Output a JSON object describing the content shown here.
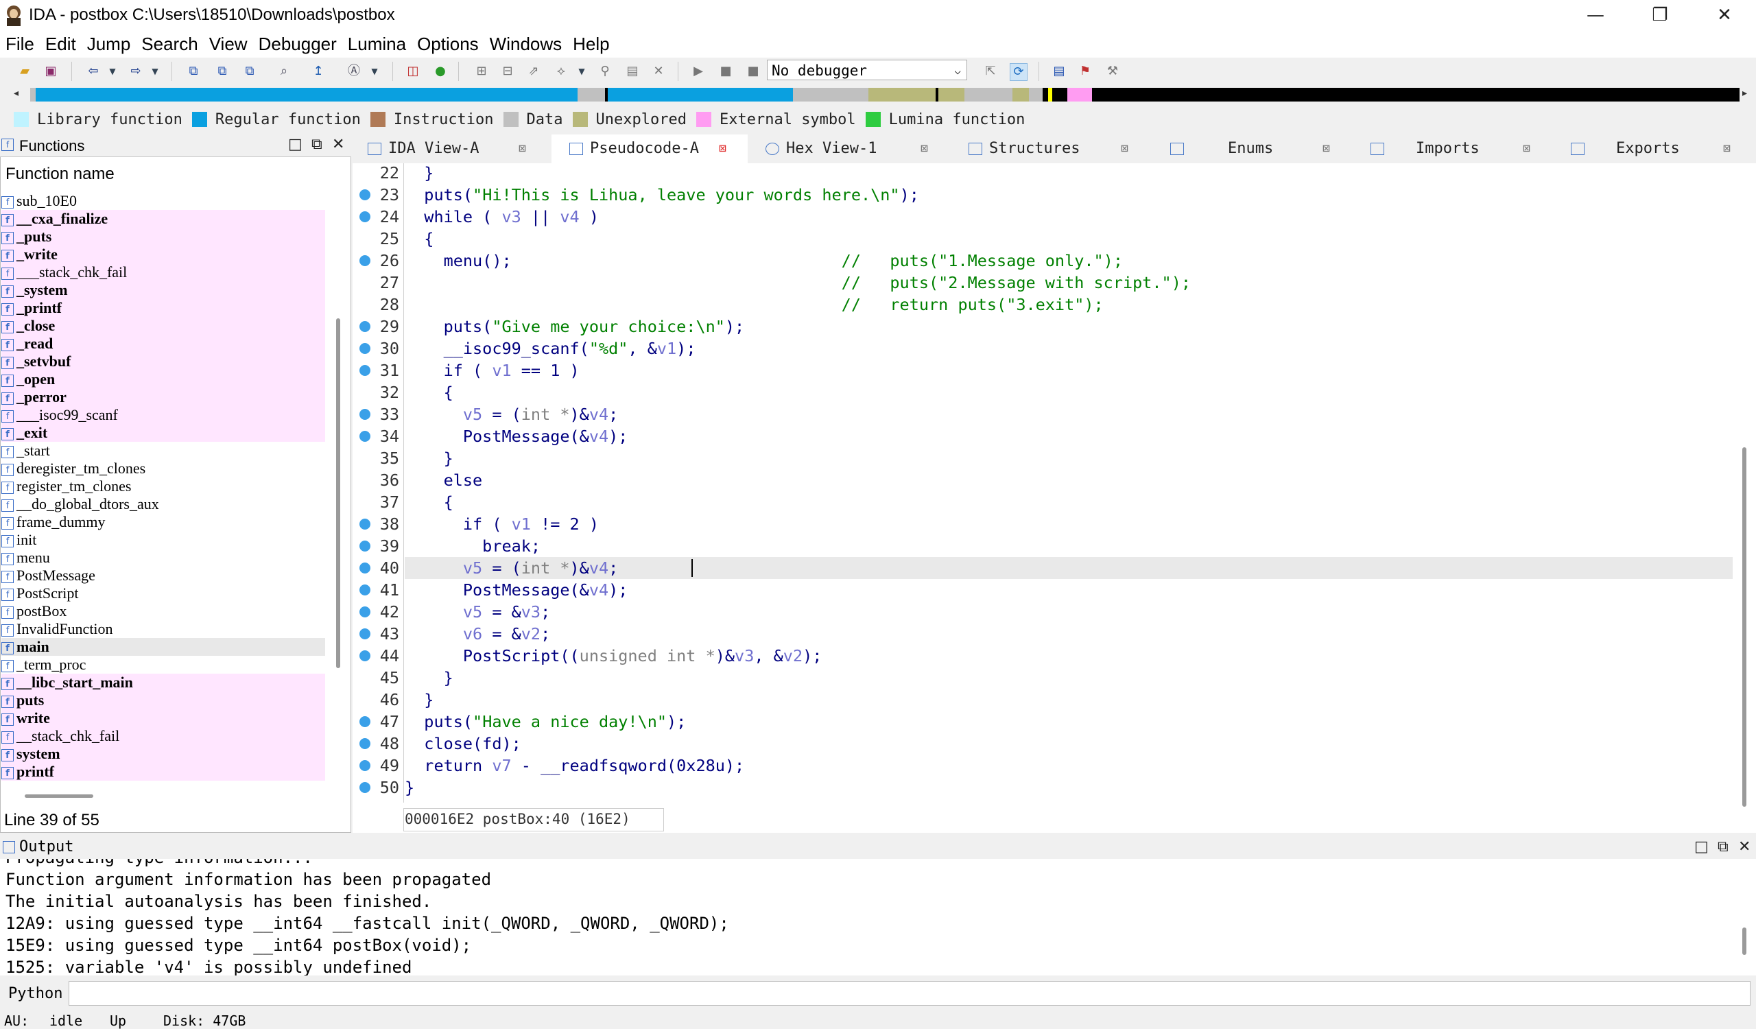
{
  "window": {
    "title": "IDA - postbox C:\\Users\\18510\\Downloads\\postbox",
    "minimize": "—",
    "maximize": "❐",
    "close": "✕"
  },
  "menu": [
    "File",
    "Edit",
    "Jump",
    "Search",
    "View",
    "Debugger",
    "Lumina",
    "Options",
    "Windows",
    "Help"
  ],
  "toolbar": {
    "debugger": "No debugger"
  },
  "legend": [
    {
      "label": "Library function",
      "color": "#bff3ff"
    },
    {
      "label": "Regular function",
      "color": "#0aa0e0"
    },
    {
      "label": "Instruction",
      "color": "#b07a56"
    },
    {
      "label": "Data",
      "color": "#c0c0c0"
    },
    {
      "label": "Unexplored",
      "color": "#b8b87a"
    },
    {
      "label": "External symbol",
      "color": "#ff9cf2"
    },
    {
      "label": "Lumina function",
      "color": "#2ecc40"
    }
  ],
  "functions": {
    "title": "Functions",
    "column": "Function name",
    "status": "Line 39 of 55",
    "items": [
      {
        "name": "sub_10E0",
        "style": "normal"
      },
      {
        "name": "__cxa_finalize",
        "style": "imp-bold"
      },
      {
        "name": "_puts",
        "style": "imp-bold"
      },
      {
        "name": "_write",
        "style": "imp-bold"
      },
      {
        "name": "___stack_chk_fail",
        "style": "imp"
      },
      {
        "name": "_system",
        "style": "imp-bold"
      },
      {
        "name": "_printf",
        "style": "imp-bold"
      },
      {
        "name": "_close",
        "style": "imp-bold"
      },
      {
        "name": "_read",
        "style": "imp-bold"
      },
      {
        "name": "_setvbuf",
        "style": "imp-bold"
      },
      {
        "name": "_open",
        "style": "imp-bold"
      },
      {
        "name": "_perror",
        "style": "imp-bold"
      },
      {
        "name": "___isoc99_scanf",
        "style": "imp"
      },
      {
        "name": "_exit",
        "style": "imp-bold"
      },
      {
        "name": "_start",
        "style": "normal"
      },
      {
        "name": "deregister_tm_clones",
        "style": "normal"
      },
      {
        "name": "register_tm_clones",
        "style": "normal"
      },
      {
        "name": "__do_global_dtors_aux",
        "style": "normal"
      },
      {
        "name": "frame_dummy",
        "style": "normal"
      },
      {
        "name": "init",
        "style": "normal"
      },
      {
        "name": "menu",
        "style": "normal"
      },
      {
        "name": "PostMessage",
        "style": "normal"
      },
      {
        "name": "PostScript",
        "style": "normal"
      },
      {
        "name": "postBox",
        "style": "normal"
      },
      {
        "name": "InvalidFunction",
        "style": "normal"
      },
      {
        "name": "main",
        "style": "sel-bold"
      },
      {
        "name": "_term_proc",
        "style": "normal"
      },
      {
        "name": "__libc_start_main",
        "style": "imp-bold"
      },
      {
        "name": "puts",
        "style": "imp-bold"
      },
      {
        "name": "write",
        "style": "imp-bold"
      },
      {
        "name": "__stack_chk_fail",
        "style": "imp"
      },
      {
        "name": "system",
        "style": "imp-bold"
      },
      {
        "name": "printf",
        "style": "imp-bold"
      }
    ]
  },
  "tabs": [
    {
      "label": "IDA View-A"
    },
    {
      "label": "Pseudocode-A"
    },
    {
      "label": "Hex View-1"
    },
    {
      "label": "Structures"
    },
    {
      "label": "Enums"
    },
    {
      "label": "Imports"
    },
    {
      "label": "Exports"
    }
  ],
  "code": {
    "lines": [
      {
        "n": "22",
        "bp": false,
        "parts": [
          [
            "  }",
            "k"
          ]
        ]
      },
      {
        "n": "23",
        "bp": true,
        "parts": [
          [
            "  puts(",
            "k"
          ],
          [
            "\"Hi!This is Lihua, leave your words here.\\n\"",
            "s"
          ],
          [
            ");",
            "k"
          ]
        ]
      },
      {
        "n": "24",
        "bp": true,
        "parts": [
          [
            "  while ( ",
            "k"
          ],
          [
            "v3",
            "v"
          ],
          [
            " || ",
            "k"
          ],
          [
            "v4",
            "v"
          ],
          [
            " )",
            "k"
          ]
        ]
      },
      {
        "n": "25",
        "bp": false,
        "parts": [
          [
            "  {",
            "k"
          ]
        ]
      },
      {
        "n": "26",
        "bp": true,
        "parts": [
          [
            "    menu();                                  ",
            "k"
          ],
          [
            "//   puts(\"1.Message only.\");",
            "c"
          ]
        ]
      },
      {
        "n": "27",
        "bp": false,
        "parts": [
          [
            "                                             ",
            "k"
          ],
          [
            "//   puts(\"2.Message with script.\");",
            "c"
          ]
        ]
      },
      {
        "n": "28",
        "bp": false,
        "parts": [
          [
            "                                             ",
            "k"
          ],
          [
            "//   return puts(\"3.exit\");",
            "c"
          ]
        ]
      },
      {
        "n": "29",
        "bp": true,
        "parts": [
          [
            "    puts(",
            "k"
          ],
          [
            "\"Give me your choice:\\n\"",
            "s"
          ],
          [
            ");",
            "k"
          ]
        ]
      },
      {
        "n": "30",
        "bp": true,
        "parts": [
          [
            "    __isoc99_scanf(",
            "k"
          ],
          [
            "\"%d\"",
            "s"
          ],
          [
            ", &",
            "k"
          ],
          [
            "v1",
            "v"
          ],
          [
            ");",
            "k"
          ]
        ]
      },
      {
        "n": "31",
        "bp": true,
        "parts": [
          [
            "    if ( ",
            "k"
          ],
          [
            "v1",
            "v"
          ],
          [
            " == 1 )",
            "k"
          ]
        ]
      },
      {
        "n": "32",
        "bp": false,
        "parts": [
          [
            "    {",
            "k"
          ]
        ]
      },
      {
        "n": "33",
        "bp": true,
        "parts": [
          [
            "      ",
            "k"
          ],
          [
            "v5",
            "v"
          ],
          [
            " = (",
            "k"
          ],
          [
            "int *",
            "g"
          ],
          [
            ")&",
            "k"
          ],
          [
            "v4",
            "v"
          ],
          [
            ";",
            "k"
          ]
        ]
      },
      {
        "n": "34",
        "bp": true,
        "parts": [
          [
            "      PostMessage(&",
            "k"
          ],
          [
            "v4",
            "v"
          ],
          [
            ");",
            "k"
          ]
        ]
      },
      {
        "n": "35",
        "bp": false,
        "parts": [
          [
            "    }",
            "k"
          ]
        ]
      },
      {
        "n": "36",
        "bp": false,
        "parts": [
          [
            "    else",
            "k"
          ]
        ]
      },
      {
        "n": "37",
        "bp": false,
        "parts": [
          [
            "    {",
            "k"
          ]
        ]
      },
      {
        "n": "38",
        "bp": true,
        "parts": [
          [
            "      if ( ",
            "k"
          ],
          [
            "v1",
            "v"
          ],
          [
            " != 2 )",
            "k"
          ]
        ]
      },
      {
        "n": "39",
        "bp": true,
        "parts": [
          [
            "        break;",
            "k"
          ]
        ]
      },
      {
        "n": "40",
        "bp": true,
        "parts": [
          [
            "      ",
            "k"
          ],
          [
            "v5",
            "v"
          ],
          [
            " = (",
            "k"
          ],
          [
            "int *",
            "g"
          ],
          [
            ")&",
            "k"
          ],
          [
            "v4",
            "v"
          ],
          [
            ";",
            "k"
          ]
        ]
      },
      {
        "n": "41",
        "bp": true,
        "parts": [
          [
            "      PostMessage(&",
            "k"
          ],
          [
            "v4",
            "v"
          ],
          [
            ");",
            "k"
          ]
        ]
      },
      {
        "n": "42",
        "bp": true,
        "parts": [
          [
            "      ",
            "k"
          ],
          [
            "v5",
            "v"
          ],
          [
            " = &",
            "k"
          ],
          [
            "v3",
            "v"
          ],
          [
            ";",
            "k"
          ]
        ]
      },
      {
        "n": "43",
        "bp": true,
        "parts": [
          [
            "      ",
            "k"
          ],
          [
            "v6",
            "v"
          ],
          [
            " = &",
            "k"
          ],
          [
            "v2",
            "v"
          ],
          [
            ";",
            "k"
          ]
        ]
      },
      {
        "n": "44",
        "bp": true,
        "parts": [
          [
            "      PostScript((",
            "k"
          ],
          [
            "unsigned int *",
            "g"
          ],
          [
            ")&",
            "k"
          ],
          [
            "v3",
            "v"
          ],
          [
            ", &",
            "k"
          ],
          [
            "v2",
            "v"
          ],
          [
            ");",
            "k"
          ]
        ]
      },
      {
        "n": "45",
        "bp": false,
        "parts": [
          [
            "    }",
            "k"
          ]
        ]
      },
      {
        "n": "46",
        "bp": false,
        "parts": [
          [
            "  }",
            "k"
          ]
        ]
      },
      {
        "n": "47",
        "bp": true,
        "parts": [
          [
            "  puts(",
            "k"
          ],
          [
            "\"Have a nice day!\\n\"",
            "s"
          ],
          [
            ");",
            "k"
          ]
        ]
      },
      {
        "n": "48",
        "bp": true,
        "parts": [
          [
            "  close(fd);",
            "k"
          ]
        ]
      },
      {
        "n": "49",
        "bp": true,
        "parts": [
          [
            "  return ",
            "k"
          ],
          [
            "v7",
            "v"
          ],
          [
            " - __readfsqword(0x28u);",
            "k"
          ]
        ]
      },
      {
        "n": "50",
        "bp": true,
        "parts": [
          [
            "}",
            "k"
          ]
        ]
      }
    ],
    "status": "000016E2 postBox:40 (16E2)"
  },
  "output": {
    "title": "Output",
    "lines": [
      "Propagating type information...",
      "Function argument information has been propagated",
      "The initial autoanalysis has been finished.",
      "12A9: using guessed type __int64 __fastcall init(_QWORD, _QWORD, _QWORD);",
      "15E9: using guessed type __int64 postBox(void);",
      "1525: variable 'v4' is possibly undefined"
    ],
    "python_label": "Python"
  },
  "statusbar": {
    "au_label": "AU:",
    "au_state": "idle",
    "direction": "Up",
    "disk": "Disk: 47GB"
  }
}
